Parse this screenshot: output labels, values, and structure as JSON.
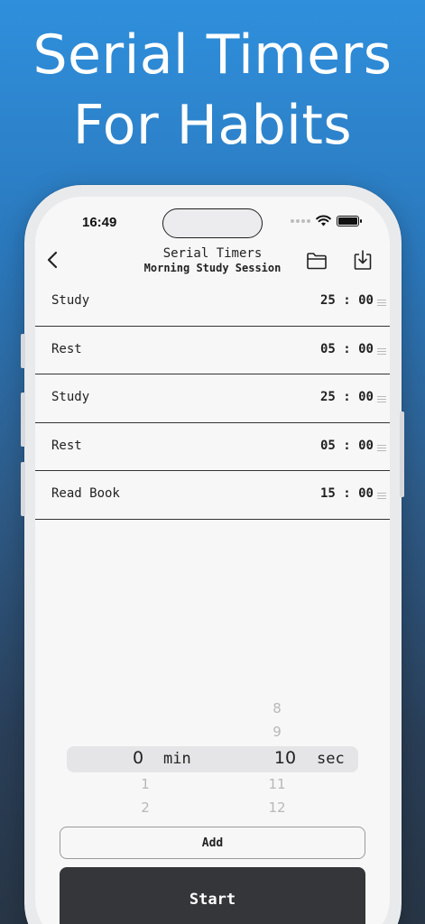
{
  "promo": {
    "line1": "Serial Timers",
    "line2": "For Habits"
  },
  "status_bar": {
    "time": "16:49"
  },
  "nav": {
    "title": "Serial Timers",
    "subtitle": "Morning Study Session"
  },
  "timers": [
    {
      "name": "Study",
      "time": "25 : 00"
    },
    {
      "name": "Rest",
      "time": "05 : 00"
    },
    {
      "name": "Study",
      "time": "25 : 00"
    },
    {
      "name": "Rest",
      "time": "05 : 00"
    },
    {
      "name": "Read Book",
      "time": "15 : 00"
    }
  ],
  "picker": {
    "minutes": {
      "above": [],
      "selected": "0",
      "below": [
        "1",
        "2"
      ],
      "label": "min"
    },
    "seconds": {
      "above": [
        "8",
        "9"
      ],
      "selected": "10",
      "below": [
        "11",
        "12"
      ],
      "label": "sec"
    }
  },
  "actions": {
    "add_label": "Add",
    "start_label": "Start"
  },
  "icons": {
    "back": "chevron-left-icon",
    "folder": "folder-icon",
    "download": "download-icon",
    "wifi": "wifi-icon",
    "battery": "battery-icon",
    "reorder": "reorder-handle-icon"
  },
  "colors": {
    "background_top": "#2f8fdc",
    "background_bottom": "#283646",
    "start_button": "#35363a"
  }
}
